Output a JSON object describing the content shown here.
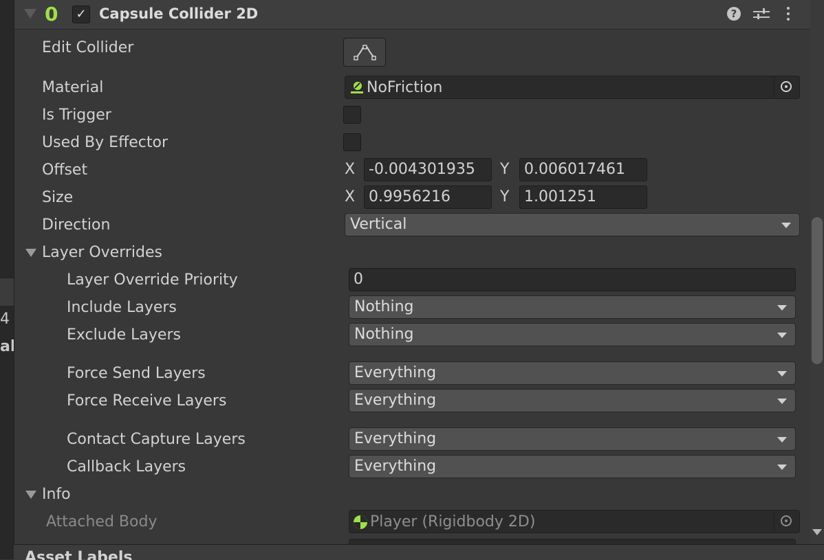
{
  "left_panel": {
    "fragment_1": "4",
    "fragment_2": "al"
  },
  "component": {
    "icon_glyph": "0",
    "enabled": true,
    "checkmark": "✓",
    "title": "Capsule Collider 2D",
    "help_glyph": "?"
  },
  "fields": {
    "edit_collider": {
      "label": "Edit Collider"
    },
    "material": {
      "label": "Material",
      "value": "NoFriction"
    },
    "is_trigger": {
      "label": "Is Trigger",
      "checked": false
    },
    "used_by_effector": {
      "label": "Used By Effector",
      "checked": false
    },
    "offset": {
      "label": "Offset",
      "x_label": "X",
      "x": "-0.004301935",
      "y_label": "Y",
      "y": "0.006017461"
    },
    "size": {
      "label": "Size",
      "x_label": "X",
      "x": "0.9956216",
      "y_label": "Y",
      "y": "1.001251"
    },
    "direction": {
      "label": "Direction",
      "value": "Vertical"
    }
  },
  "layer_overrides": {
    "label": "Layer Overrides",
    "priority": {
      "label": "Layer Override Priority",
      "value": "0"
    },
    "include_layers": {
      "label": "Include Layers",
      "value": "Nothing"
    },
    "exclude_layers": {
      "label": "Exclude Layers",
      "value": "Nothing"
    },
    "force_send_layers": {
      "label": "Force Send Layers",
      "value": "Everything"
    },
    "force_receive_layers": {
      "label": "Force Receive Layers",
      "value": "Everything"
    },
    "contact_capture_layers": {
      "label": "Contact Capture Layers",
      "value": "Everything"
    },
    "callback_layers": {
      "label": "Callback Layers",
      "value": "Everything"
    }
  },
  "info": {
    "label": "Info",
    "attached_body": {
      "label": "Attached Body",
      "value": "Player (Rigidbody 2D)"
    }
  },
  "bottom": {
    "asset_labels": "Asset Labels"
  },
  "colors": {
    "accent_green": "#9fe04a",
    "panel_bg": "#383838",
    "field_bg": "#2a2a2a",
    "dropdown_bg": "#515151"
  },
  "icons": [
    "chevron-down-icon",
    "collider-2d-icon",
    "checkbox-check-icon",
    "help-icon",
    "presets-icon",
    "kebab-menu-icon",
    "edit-collider-icon",
    "physics-material-icon",
    "object-picker-icon",
    "rigidbody-icon"
  ]
}
